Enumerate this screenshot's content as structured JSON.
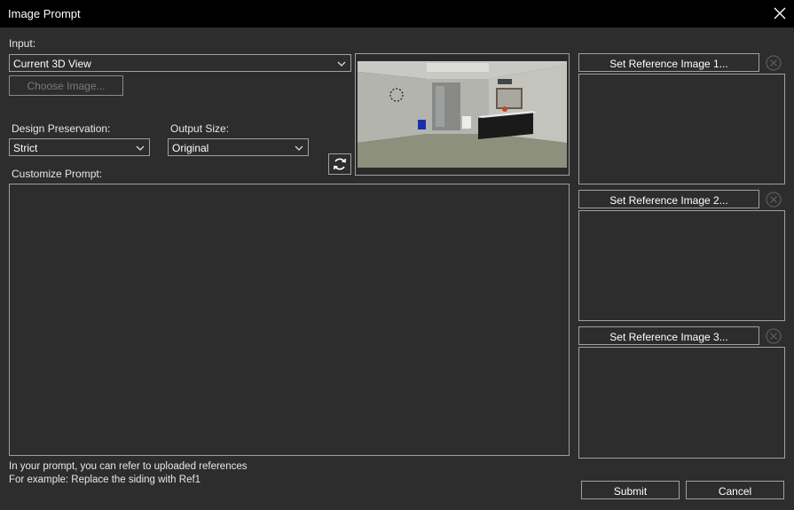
{
  "window": {
    "title": "Image Prompt",
    "close_icon": "close-icon"
  },
  "input": {
    "label": "Input:",
    "value": "Current 3D View",
    "choose_image_label": "Choose Image..."
  },
  "design_preservation": {
    "label": "Design Preservation:",
    "value": "Strict"
  },
  "output_size": {
    "label": "Output Size:",
    "value": "Original"
  },
  "refresh": {
    "icon": "refresh-icon"
  },
  "preview": {
    "icon": "bathroom-3d-preview"
  },
  "prompt": {
    "label": "Customize Prompt:",
    "value": ""
  },
  "hints": {
    "line1": "In your prompt, you can refer to uploaded references",
    "line2": "For example: Replace the siding with Ref1"
  },
  "references": [
    {
      "label": "Set Reference Image 1..."
    },
    {
      "label": "Set Reference Image 2..."
    },
    {
      "label": "Set Reference Image 3..."
    }
  ],
  "actions": {
    "submit": "Submit",
    "cancel": "Cancel"
  },
  "colors": {
    "background": "#2d2d2d",
    "titlebar": "#000000",
    "border": "#a0a0a0"
  }
}
